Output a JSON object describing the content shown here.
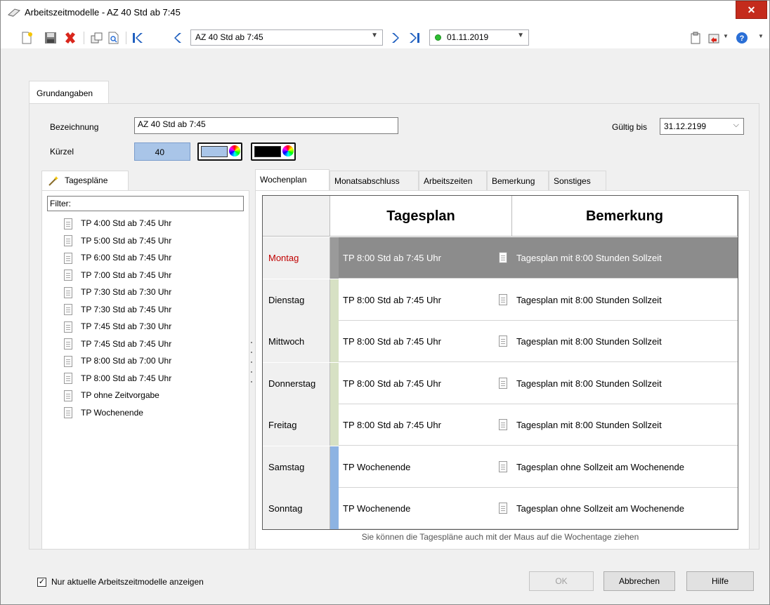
{
  "window": {
    "title": "Arbeitszeitmodelle - AZ 40 Std ab 7:45",
    "close_label": "✕"
  },
  "toolbar": {
    "model_value": "AZ 40 Std ab 7:45",
    "date_value": "01.11.2019"
  },
  "main_tab": {
    "label": "Grundangaben"
  },
  "form": {
    "bezeichnung_label": "Bezeichnung",
    "bezeichnung_value": "AZ 40 Std ab 7:45",
    "kuerzel_label": "Kürzel",
    "kuerzel_value": "40",
    "kuerzel_color_1": "#a9c5e8",
    "kuerzel_color_2": "#000000",
    "gueltig_label": "Gültig bis",
    "gueltig_value": "31.12.2199"
  },
  "tagesplaene": {
    "tab_label": "Tagespläne",
    "filter_label": "Filter:",
    "items": [
      "TP 4:00 Std ab 7:45 Uhr",
      "TP 5:00 Std ab 7:45 Uhr",
      "TP 6:00 Std ab 7:45 Uhr",
      "TP 7:00 Std ab 7:45 Uhr",
      "TP 7:30 Std ab 7:30 Uhr",
      "TP 7:30 Std ab 7:45 Uhr",
      "TP 7:45 Std ab 7:30 Uhr",
      "TP 7:45 Std ab 7:45 Uhr",
      "TP 8:00 Std ab 7:00 Uhr",
      "TP 8:00 Std ab 7:45 Uhr",
      "TP ohne Zeitvorgabe",
      "TP Wochenende"
    ]
  },
  "subtabs": [
    "Wochenplan",
    "Monatsabschluss",
    "Arbeitszeiten",
    "Bemerkung",
    "Sonstiges"
  ],
  "grid": {
    "headers": {
      "tagesplan": "Tagesplan",
      "bemerkung": "Bemerkung"
    },
    "rows": [
      {
        "day": "Montag",
        "plan": "TP 8:00 Std ab 7:45 Uhr",
        "note": "Tagesplan mit 8:00 Stunden Sollzeit",
        "bar_color": "#9a9a9a",
        "selected": true
      },
      {
        "day": "Dienstag",
        "plan": "TP 8:00 Std ab 7:45 Uhr",
        "note": "Tagesplan mit 8:00 Stunden Sollzeit",
        "bar_color": "#d7e1c4"
      },
      {
        "day": "Mittwoch",
        "plan": "TP 8:00 Std ab 7:45 Uhr",
        "note": "Tagesplan mit 8:00 Stunden Sollzeit",
        "bar_color": "#d7e1c4"
      },
      {
        "day": "Donnerstag",
        "plan": "TP 8:00 Std ab 7:45 Uhr",
        "note": "Tagesplan mit 8:00 Stunden Sollzeit",
        "bar_color": "#d7e1c4"
      },
      {
        "day": "Freitag",
        "plan": "TP 8:00 Std ab 7:45 Uhr",
        "note": "Tagesplan mit 8:00 Stunden Sollzeit",
        "bar_color": "#d7e1c4"
      },
      {
        "day": "Samstag",
        "plan": "TP Wochenende",
        "note": "Tagesplan ohne Sollzeit am Wochenende",
        "bar_color": "#8db3e2"
      },
      {
        "day": "Sonntag",
        "plan": "TP Wochenende",
        "note": "Tagesplan ohne Sollzeit am Wochenende",
        "bar_color": "#8db3e2"
      }
    ],
    "selected_day_color": "#c00000"
  },
  "hint": "Sie können die Tagespläne auch mit der Maus auf die Wochentage ziehen",
  "footer": {
    "checkbox_label": "Nur aktuelle Arbeitszeitmodelle anzeigen",
    "checkbox_mark": "✓",
    "ok_label": "OK",
    "cancel_label": "Abbrechen",
    "help_label": "Hilfe"
  }
}
